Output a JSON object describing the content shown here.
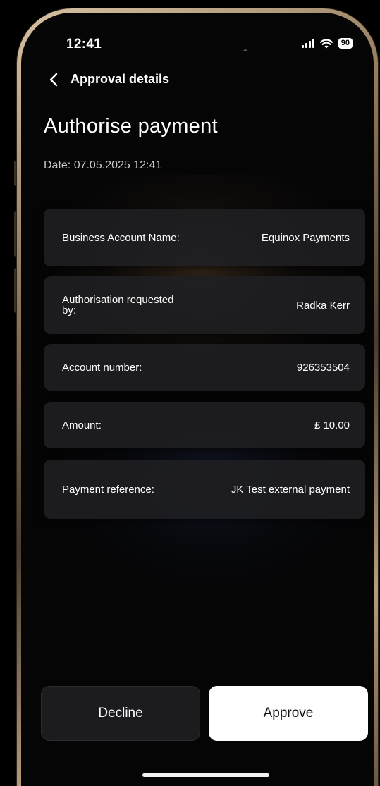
{
  "status_bar": {
    "time": "12:41",
    "battery": "90"
  },
  "header": {
    "back_icon": "chevron-left-icon",
    "title": "Approval details"
  },
  "page": {
    "title": "Authorise payment",
    "date_prefix": "Date: ",
    "date_value": "07.05.2025 12:41"
  },
  "details": [
    {
      "label": "Business Account Name:",
      "value": "Equinox Payments"
    },
    {
      "label": "Authorisation requested by:",
      "value": "Radka Kerr"
    },
    {
      "label": "Account number:",
      "value": "926353504"
    },
    {
      "label": "Amount:",
      "value": "£ 10.00"
    },
    {
      "label": "Payment reference:",
      "value": "JK Test external payment"
    }
  ],
  "actions": {
    "decline_label": "Decline",
    "approve_label": "Approve"
  },
  "colors": {
    "background": "#050506",
    "card": "#1e1e22",
    "approve_bg": "#ffffff",
    "decline_bg": "#1c1c1f",
    "frame_gold": "#b79d7d"
  }
}
